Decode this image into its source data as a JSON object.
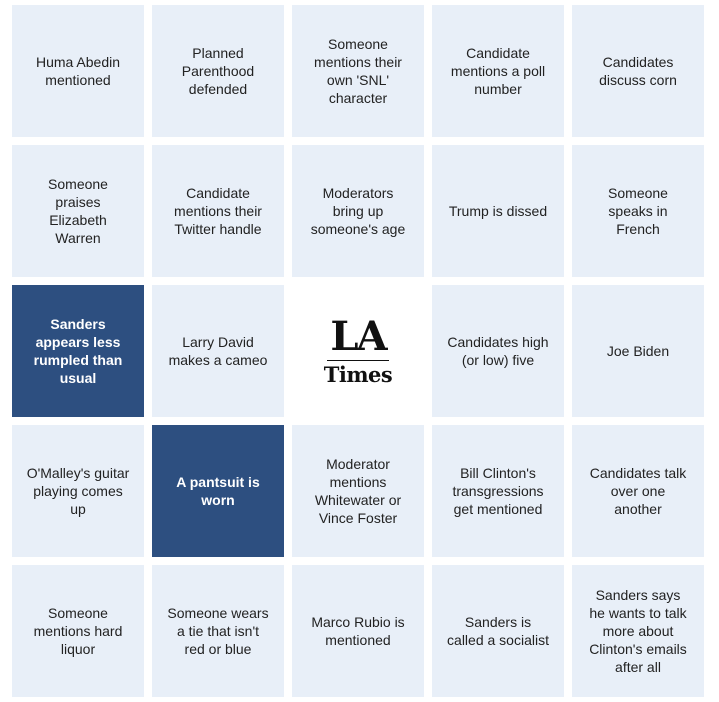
{
  "board": {
    "cells": [
      {
        "text": "Huma Abedin mentioned",
        "marked": false
      },
      {
        "text": "Planned Parenthood defended",
        "marked": false
      },
      {
        "text": "Someone mentions their own 'SNL' character",
        "marked": false
      },
      {
        "text": "Candidate mentions a poll number",
        "marked": false
      },
      {
        "text": "Candidates discuss corn",
        "marked": false
      },
      {
        "text": "Someone praises Elizabeth Warren",
        "marked": false
      },
      {
        "text": "Candidate mentions their Twitter handle",
        "marked": false
      },
      {
        "text": "Moderators bring up someone's age",
        "marked": false
      },
      {
        "text": "Trump is dissed",
        "marked": false
      },
      {
        "text": "Someone speaks in French",
        "marked": false
      },
      {
        "text": "Sanders appears less rumpled than usual",
        "marked": true
      },
      {
        "text": "Larry David makes a cameo",
        "marked": false
      },
      {
        "text": "",
        "marked": false,
        "free": true
      },
      {
        "text": "Candidates high (or low) five",
        "marked": false
      },
      {
        "text": "Joe Biden",
        "marked": false
      },
      {
        "text": "O'Malley's guitar playing comes up",
        "marked": false
      },
      {
        "text": "A pantsuit is worn",
        "marked": true
      },
      {
        "text": "Moderator mentions Whitewater or Vince Foster",
        "marked": false
      },
      {
        "text": "Bill Clinton's transgressions get mentioned",
        "marked": false
      },
      {
        "text": "Candidates talk over one another",
        "marked": false
      },
      {
        "text": "Someone mentions hard liquor",
        "marked": false
      },
      {
        "text": "Someone wears a tie that isn't red or blue",
        "marked": false
      },
      {
        "text": "Marco Rubio is mentioned",
        "marked": false
      },
      {
        "text": "Sanders is called a socialist",
        "marked": false
      },
      {
        "text": "Sanders says he wants to talk more about Clinton's emails after all",
        "marked": false
      }
    ]
  },
  "logo": {
    "line1": "LA",
    "line2": "Times"
  },
  "colors": {
    "cell": "#e8eff8",
    "marked": "#2d4f80",
    "marked_text": "#ffffff",
    "text": "#222222"
  }
}
